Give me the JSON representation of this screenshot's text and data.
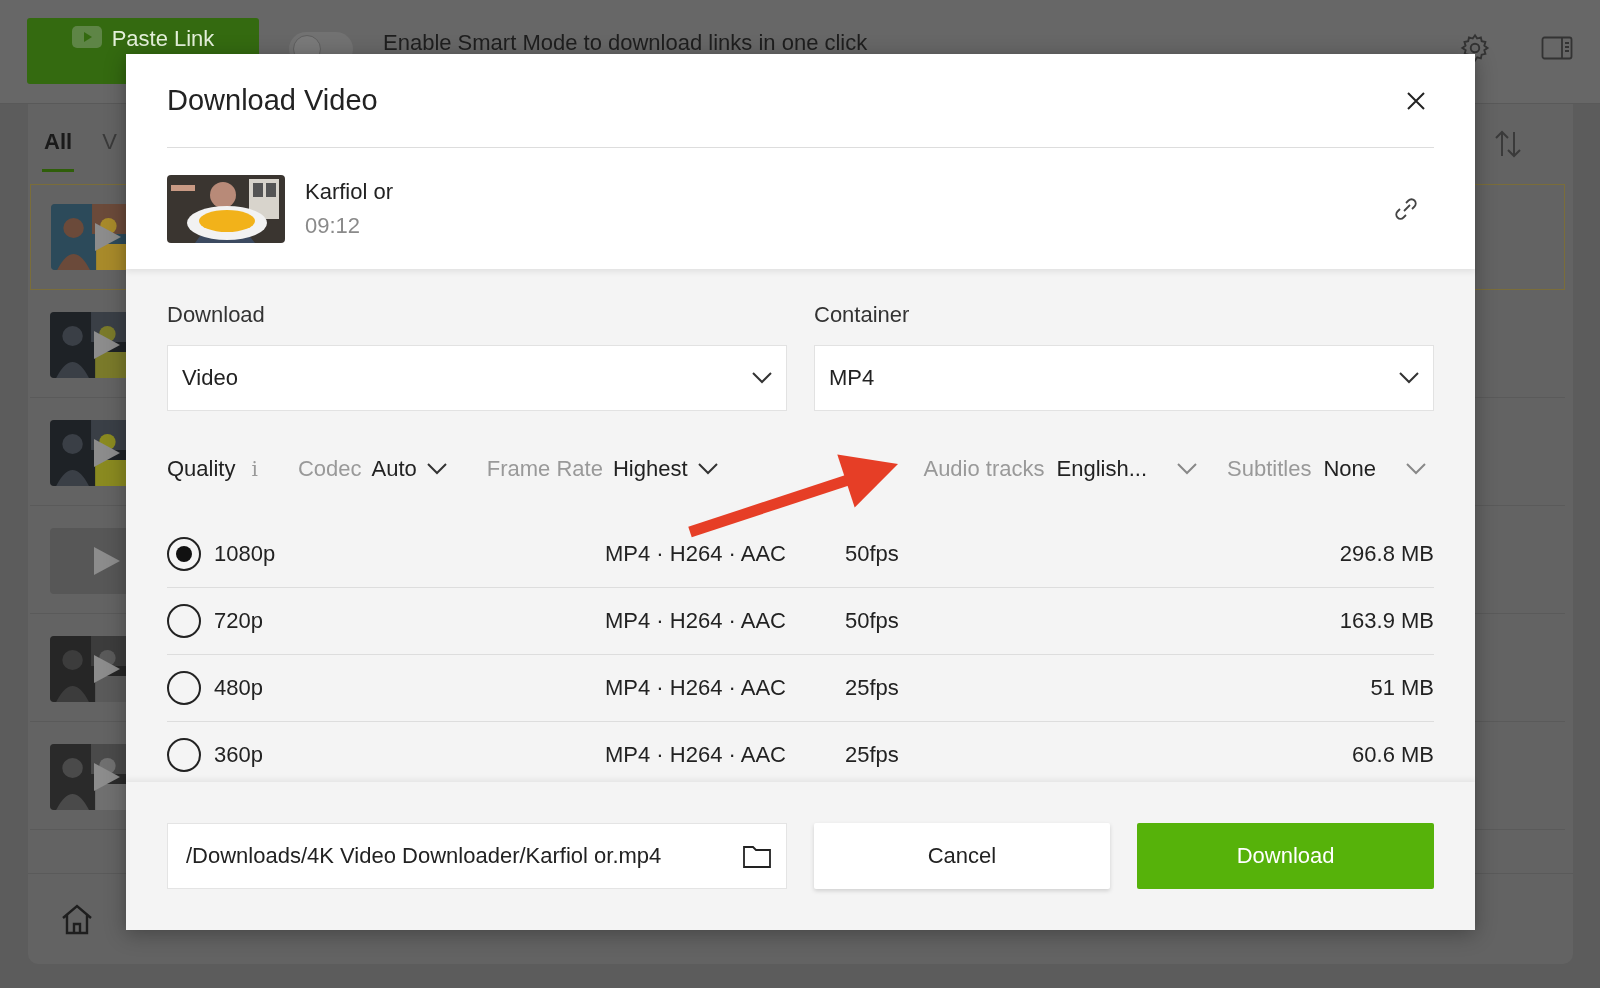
{
  "background_app": {
    "paste_button": "Paste Link",
    "smart_mode": {
      "on": false,
      "label": "Enable Smart Mode to download links in one click"
    },
    "tabs": [
      {
        "label": "All",
        "selected": true
      },
      {
        "label": "V",
        "selected": false
      }
    ],
    "items": [
      {
        "kind": "picture",
        "selected": true
      },
      {
        "kind": "picture",
        "selected": false
      },
      {
        "kind": "picture",
        "selected": false
      },
      {
        "kind": "empty",
        "selected": false
      },
      {
        "kind": "picture",
        "selected": false
      },
      {
        "kind": "picture",
        "selected": false
      }
    ]
  },
  "dialog": {
    "title": "Download Video",
    "video": {
      "title": "Karfiol or",
      "duration": "09:12"
    },
    "selects": [
      {
        "label": "Download",
        "value": "Video"
      },
      {
        "label": "Container",
        "value": "MP4"
      }
    ],
    "filters_left": [
      {
        "kind": "info",
        "label": "Quality",
        "icon": "i"
      },
      {
        "kind": "dropdown",
        "label": "Codec",
        "value": "Auto"
      },
      {
        "kind": "dropdown",
        "label": "Frame Rate",
        "value": "Highest"
      }
    ],
    "filters_right": [
      {
        "kind": "dropdown",
        "label": "Audio tracks",
        "value": "English..."
      },
      {
        "kind": "dropdown",
        "label": "Subtitles",
        "value": "None"
      }
    ],
    "formats": [
      {
        "resolution": "1080p",
        "codec": "MP4 · H264 · AAC",
        "fps": "50fps",
        "size": "296.8 MB",
        "selected": true
      },
      {
        "resolution": "720p",
        "codec": "MP4 · H264 · AAC",
        "fps": "50fps",
        "size": "163.9 MB",
        "selected": false
      },
      {
        "resolution": "480p",
        "codec": "MP4 · H264 · AAC",
        "fps": "25fps",
        "size": "51 MB",
        "selected": false
      },
      {
        "resolution": "360p",
        "codec": "MP4 · H264 · AAC",
        "fps": "25fps",
        "size": "60.6 MB",
        "selected": false
      }
    ],
    "save_path": "/Downloads/4K Video Downloader/Karfiol or.mp4",
    "buttons": {
      "cancel": "Cancel",
      "download": "Download"
    }
  }
}
